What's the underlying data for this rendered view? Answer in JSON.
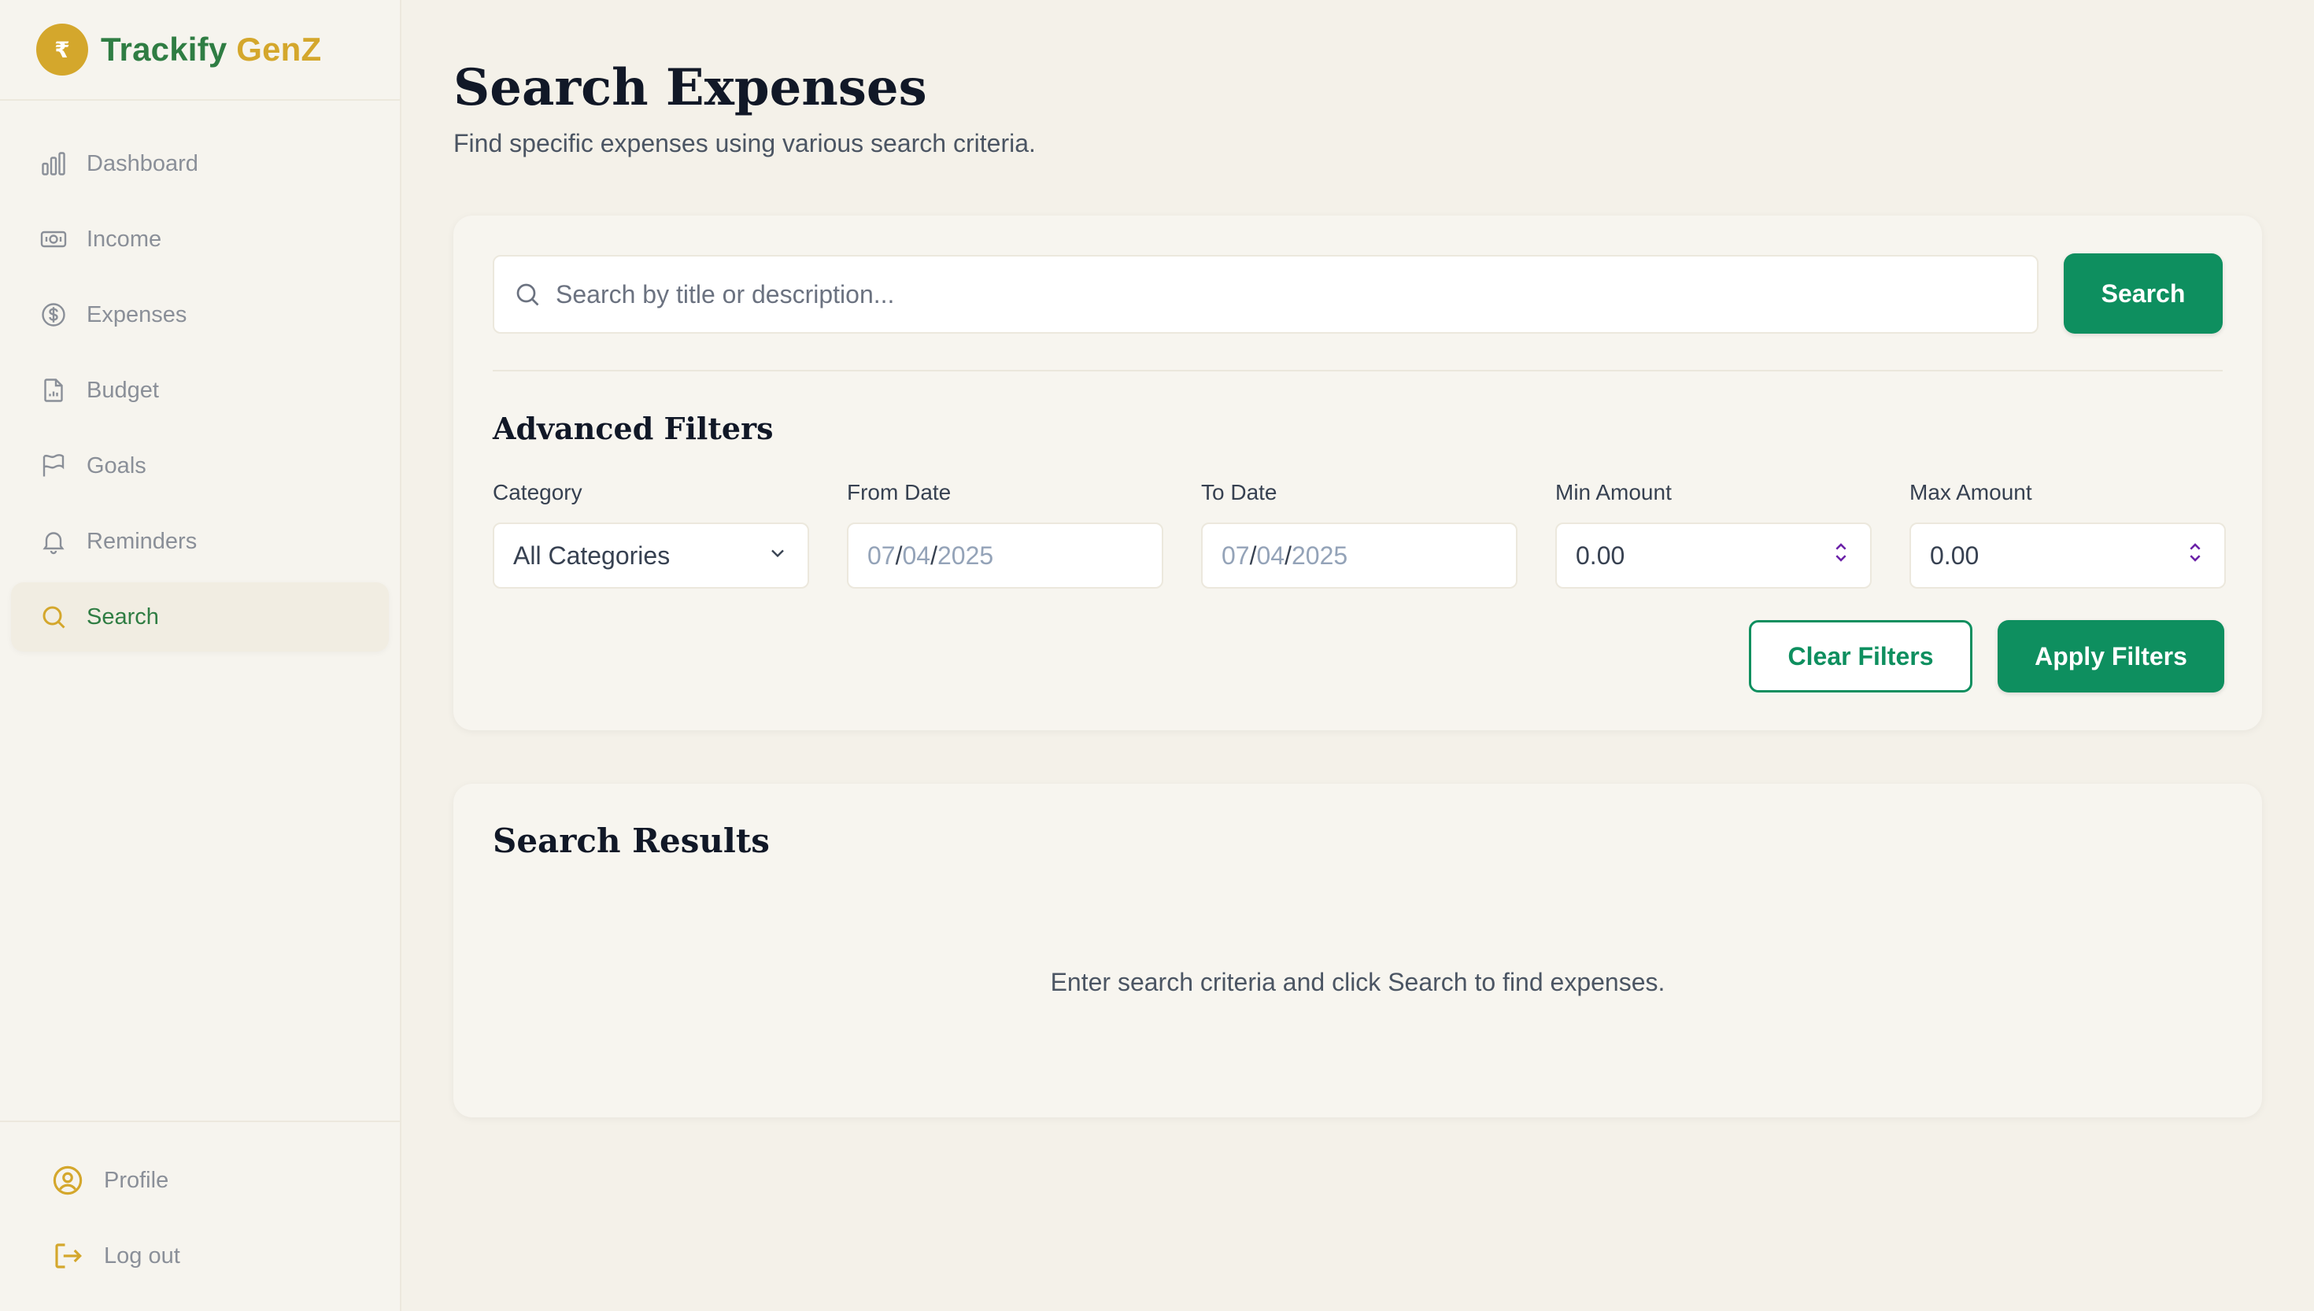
{
  "brand": {
    "logo_symbol": "₹",
    "name_part1": "Trackify",
    "name_part2": "GenZ",
    "colors": {
      "green": "#2f7d43",
      "gold": "#d4a72c"
    }
  },
  "sidebar": {
    "items": [
      {
        "label": "Dashboard",
        "icon": "bar-chart-icon"
      },
      {
        "label": "Income",
        "icon": "banknote-icon"
      },
      {
        "label": "Expenses",
        "icon": "dollar-circle-icon"
      },
      {
        "label": "Budget",
        "icon": "document-icon"
      },
      {
        "label": "Goals",
        "icon": "flag-icon"
      },
      {
        "label": "Reminders",
        "icon": "bell-icon"
      },
      {
        "label": "Search",
        "icon": "search-icon",
        "active": true
      }
    ],
    "bottom": [
      {
        "label": "Profile",
        "icon": "user-circle-icon"
      },
      {
        "label": "Log out",
        "icon": "logout-icon"
      }
    ]
  },
  "page": {
    "title": "Search Expenses",
    "subtitle": "Find specific expenses using various search criteria."
  },
  "search": {
    "placeholder": "Search by title or description...",
    "value": "",
    "button_label": "Search"
  },
  "filters": {
    "title": "Advanced Filters",
    "category": {
      "label": "Category",
      "value": "All Categories"
    },
    "from_date": {
      "label": "From Date",
      "mm": "07",
      "dd": "04",
      "yyyy": "2025"
    },
    "to_date": {
      "label": "To Date",
      "mm": "07",
      "dd": "04",
      "yyyy": "2025"
    },
    "min_amount": {
      "label": "Min Amount",
      "value": "0.00"
    },
    "max_amount": {
      "label": "Max Amount",
      "value": "0.00"
    },
    "clear_label": "Clear Filters",
    "apply_label": "Apply Filters"
  },
  "results": {
    "title": "Search Results",
    "empty_message": "Enter search criteria and click Search to find expenses."
  },
  "theme": {
    "accent": "#0e8f5f",
    "background": "#f4f1e9",
    "card": "#f7f5ef"
  }
}
